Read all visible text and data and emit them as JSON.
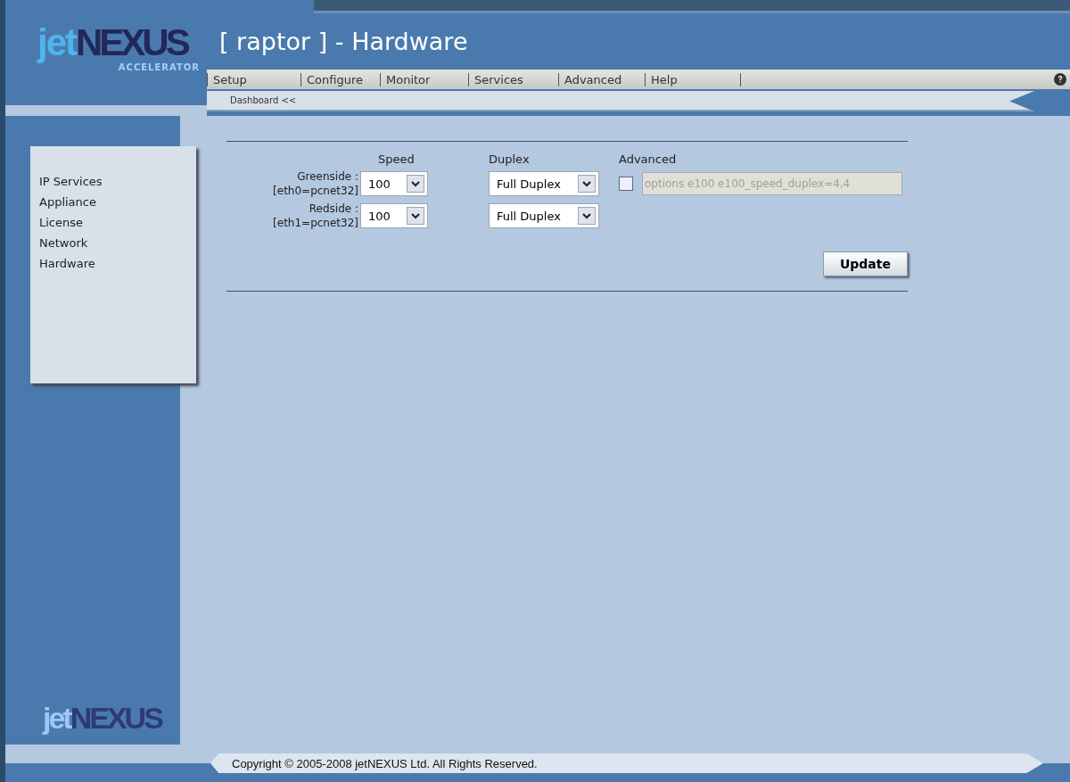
{
  "logo": {
    "jet": "jet",
    "nexus": "NEXUS",
    "tagline": "ACCELERATOR"
  },
  "title": "[ raptor ] - Hardware",
  "menu": [
    "Setup",
    "Configure",
    "Monitor",
    "Services",
    "Advanced",
    "Help"
  ],
  "breadcrumb": "Dashboard <<",
  "sidebar": {
    "items": [
      "IP Services",
      "Appliance",
      "License",
      "Network",
      "Hardware"
    ]
  },
  "form": {
    "columns": [
      "Speed",
      "Duplex",
      "Advanced"
    ],
    "rows": [
      {
        "label": "Greenside :",
        "device": "[eth0=pcnet32]",
        "speed": "100",
        "duplex": "Full Duplex"
      },
      {
        "label": "Redside :",
        "device": "[eth1=pcnet32]",
        "speed": "100",
        "duplex": "Full Duplex"
      }
    ],
    "advanced": {
      "checked": false,
      "value": "options e100 e100_speed_duplex=4,4"
    },
    "button": "Update"
  },
  "bottom_logo": {
    "jet": "jet",
    "nexus": "NEXUS"
  },
  "footer": "Copyright © 2005-2008 jetNEXUS Ltd. All Rights Reserved."
}
